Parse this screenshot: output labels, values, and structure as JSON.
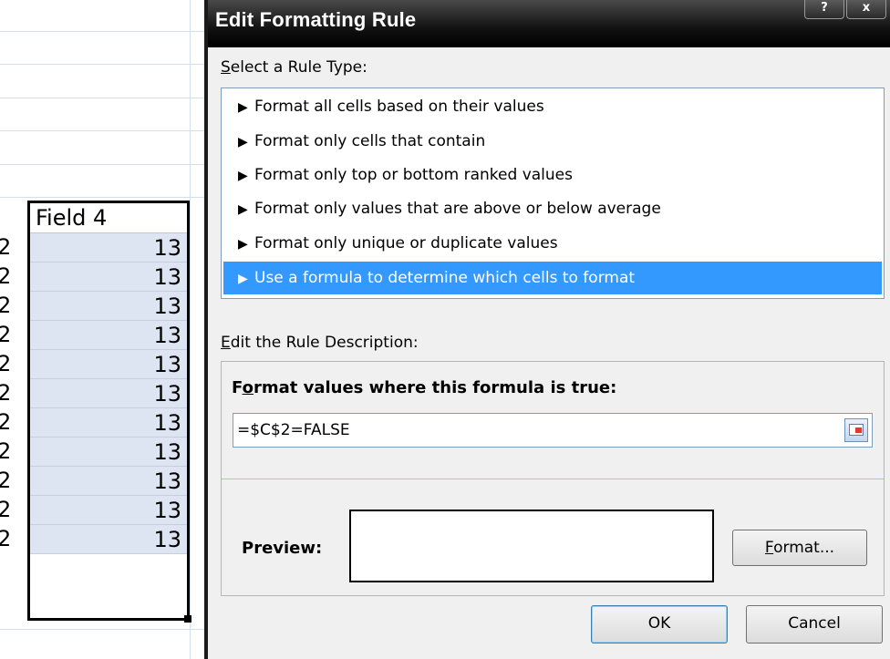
{
  "sheet": {
    "left_digits": [
      "2",
      "2",
      "2",
      "2",
      "2",
      "2",
      "2",
      "2",
      "2",
      "2",
      "2"
    ],
    "field_header": "Field 4",
    "field_values": [
      "13",
      "13",
      "13",
      "13",
      "13",
      "13",
      "13",
      "13",
      "13",
      "13",
      "13"
    ]
  },
  "dialog": {
    "title": "Edit Formatting Rule",
    "title_buttons": {
      "help": "?",
      "close": "x"
    },
    "rule_type_label": {
      "accel": "S",
      "rest": "elect a Rule Type:"
    },
    "rule_types": [
      "Format all cells based on their values",
      "Format only cells that contain",
      "Format only top or bottom ranked values",
      "Format only values that are above or below average",
      "Format only unique or duplicate values",
      "Use a formula to determine which cells to format"
    ],
    "selected_rule_index": 5,
    "description_label": {
      "accel": "E",
      "rest": "dit the Rule Description:"
    },
    "formula_label": {
      "pre": "F",
      "accel": "o",
      "rest": "rmat values where this formula is true:"
    },
    "formula_value": "=$C$2=FALSE",
    "preview_label": "Preview:",
    "format_button": {
      "accel": "F",
      "rest": "ormat..."
    },
    "ok_label": "OK",
    "cancel_label": "Cancel"
  }
}
